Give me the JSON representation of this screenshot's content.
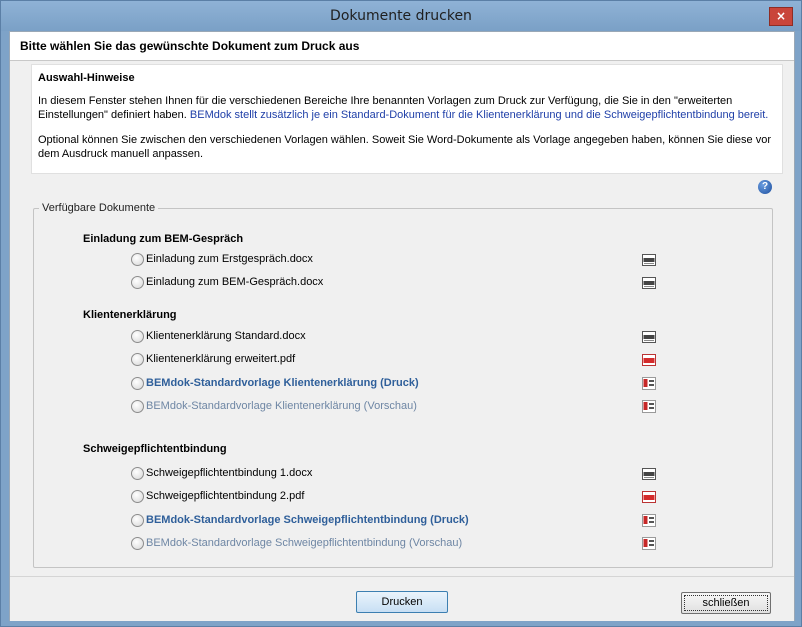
{
  "window": {
    "title": "Dokumente drucken",
    "close_glyph": "×"
  },
  "header": {
    "text": "Bitte wählen Sie das gewünschte Dokument zum Druck aus"
  },
  "hint": {
    "title": "Auswahl-Hinweise",
    "p1_plain": "In diesem Fenster stehen Ihnen für die verschiedenen Bereiche Ihre benannten Vorlagen zum Druck zur Verfügung, die Sie in den \"erweiterten Einstellungen\" definiert haben. ",
    "p1_blue": "BEMdok stellt zusätzlich je ein Standard-Dokument für die Klientenerklärung und die Schweigepflichtentbindung bereit.",
    "p2": "Optional können Sie zwischen den verschiedenen Vorlagen wählen. Soweit Sie Word-Dokumente als Vorlage angegeben haben, können Sie diese vor dem Ausdruck manuell anpassen."
  },
  "help_icon": "?",
  "group": {
    "legend": "Verfügbare Dokumente",
    "sections": [
      {
        "title": "Einladung zum BEM-Gespräch",
        "items": [
          {
            "label": "Einladung zum Erstgespräch.docx",
            "style": "normal",
            "icon": "docx-file-icon"
          },
          {
            "label": "Einladung zum BEM-Gespräch.docx",
            "style": "normal",
            "icon": "docx-file-icon"
          }
        ]
      },
      {
        "title": "Klientenerklärung",
        "items": [
          {
            "label": "Klientenerklärung Standard.docx",
            "style": "normal",
            "icon": "docx-file-icon"
          },
          {
            "label": "Klientenerklärung erweitert.pdf",
            "style": "normal",
            "icon": "pdf-file-icon"
          },
          {
            "label": "BEMdok-Standardvorlage Klientenerklärung (Druck)",
            "style": "bold",
            "icon": "bem-file-icon"
          },
          {
            "label": "BEMdok-Standardvorlage Klientenerklärung (Vorschau)",
            "style": "dim",
            "icon": "bem-file-icon"
          }
        ]
      },
      {
        "title": "Schweigepflichtentbindung",
        "items": [
          {
            "label": "Schweigepflichtentbindung 1.docx",
            "style": "normal",
            "icon": "docx-file-icon"
          },
          {
            "label": "Schweigepflichtentbindung 2.pdf",
            "style": "normal",
            "icon": "pdf-file-icon"
          },
          {
            "label": "BEMdok-Standardvorlage Schweigepflichtentbindung (Druck)",
            "style": "bold",
            "icon": "bem-file-icon"
          },
          {
            "label": "BEMdok-Standardvorlage Schweigepflichtentbindung (Vorschau)",
            "style": "dim",
            "icon": "bem-file-icon"
          }
        ]
      }
    ]
  },
  "footer": {
    "print_label": "Drucken",
    "close_label": "schließen"
  },
  "colors": {
    "title_bar": "#7ea3c8",
    "link_blue": "#1f3fa8",
    "bold_item": "#2f5f9a",
    "dim_item": "#6e86a4",
    "pdf_red": "#d42b2b"
  }
}
